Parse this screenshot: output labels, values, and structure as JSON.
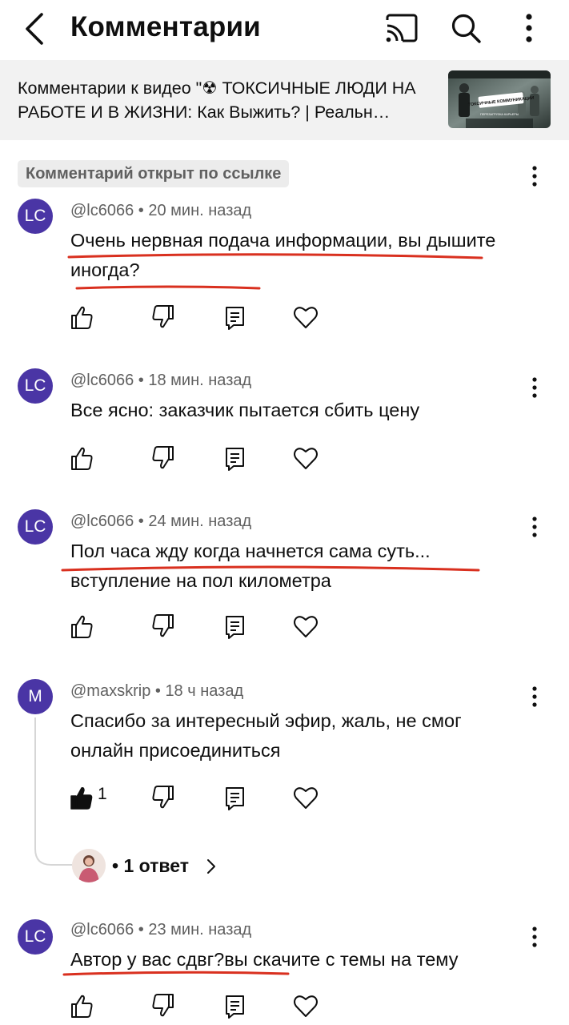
{
  "header": {
    "title": "Комментарии",
    "back_icon": "chevron-left-icon",
    "cast_icon": "cast-icon",
    "search_icon": "search-icon",
    "more_icon": "more-vertical-icon"
  },
  "video": {
    "title": "Комментарии к видео \"☢ ТОКСИЧНЫЕ ЛЮДИ НА РАБОТЕ И В ЖИЗНИ: Как Выжить? | Реальн…",
    "thumbnail_text": "ТОКСИЧНЫЕ КОММУНИКАЦИИ",
    "thumbnail_subtext": "ПЕРЕЗАГРУЗКА КАРЬЕРЫ"
  },
  "chip": "Комментарий открыт по ссылке",
  "colors": {
    "avatar_purple": "#4a35a5",
    "underline_red": "#d9301f",
    "meta_gray": "#606060",
    "strip_bg": "#f2f2f2"
  },
  "comments": [
    {
      "avatar": "LC",
      "author": "@lc6066",
      "time": "20 мин. назад",
      "text": "Очень нервная подача информации, вы дышите иногда?",
      "likes": ""
    },
    {
      "avatar": "LC",
      "author": "@lc6066",
      "time": "18 мин. назад",
      "text": "Все ясно: заказчик пытается сбить цену",
      "likes": ""
    },
    {
      "avatar": "LC",
      "author": "@lc6066",
      "time": "24 мин. назад",
      "text": "Пол часа жду когда начнется сама суть... вступление на пол километра",
      "likes": ""
    },
    {
      "avatar": "M",
      "author": "@maxskrip",
      "time": "18 ч назад",
      "text": "Спасибо за интересный эфир, жаль, не смог онлайн присоединиться",
      "likes": "1",
      "replies": "1 ответ"
    },
    {
      "avatar": "LC",
      "author": "@lc6066",
      "time": "23 мин. назад",
      "text": "Автор у вас сдвг?вы скачите с темы на тему",
      "likes": ""
    }
  ],
  "separator": " • "
}
